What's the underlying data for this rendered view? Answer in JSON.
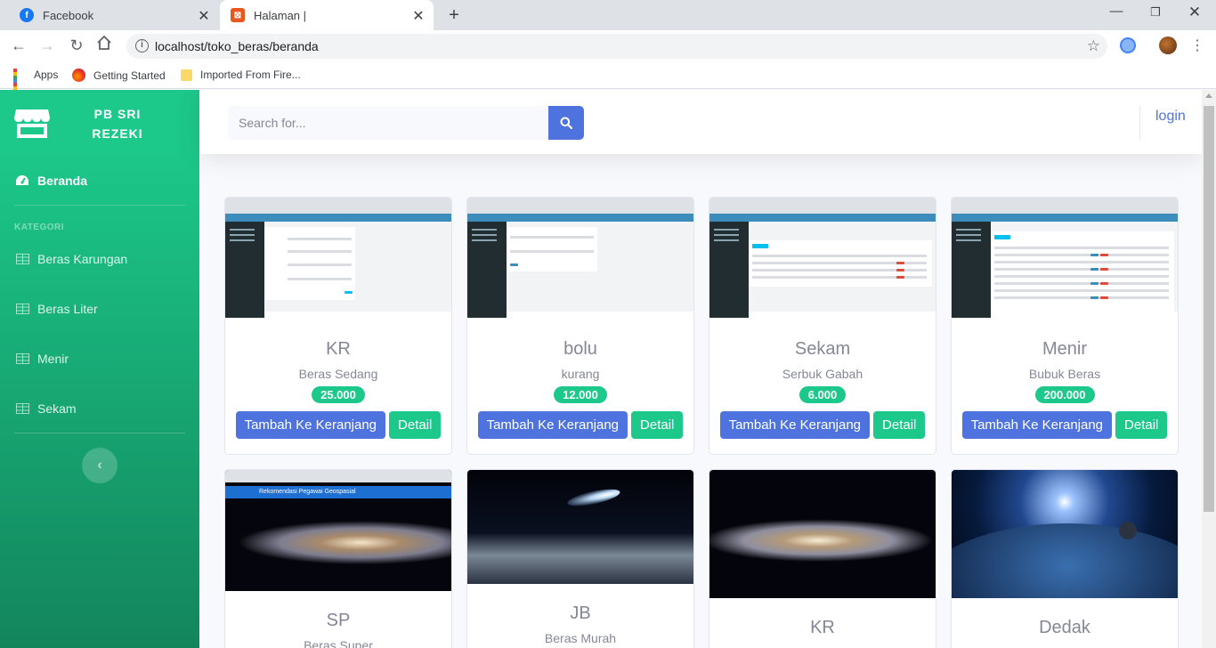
{
  "browser": {
    "tabs": [
      {
        "title": "Facebook"
      },
      {
        "title": "Halaman |"
      }
    ],
    "url": "localhost/toko_beras/beranda",
    "bookmarks": [
      {
        "label": "Apps"
      },
      {
        "label": "Getting Started"
      },
      {
        "label": "Imported From Fire..."
      }
    ]
  },
  "sidebar": {
    "brand": "PB SRI REZEKI",
    "dashboard_label": "Beranda",
    "heading": "KATEGORI",
    "items": [
      {
        "label": "Beras Karungan"
      },
      {
        "label": "Beras Liter"
      },
      {
        "label": "Menir"
      },
      {
        "label": "Sekam"
      }
    ]
  },
  "topbar": {
    "search_placeholder": "Search for...",
    "login": "login"
  },
  "products": [
    {
      "title": "KR",
      "subtitle": "Beras Sedang",
      "price": "25.000",
      "cart_label": "Tambah Ke Keranjang",
      "detail_label": "Detail"
    },
    {
      "title": "bolu",
      "subtitle": "kurang",
      "price": "12.000",
      "cart_label": "Tambah Ke Keranjang",
      "detail_label": "Detail"
    },
    {
      "title": "Sekam",
      "subtitle": "Serbuk Gabah",
      "price": "6.000",
      "cart_label": "Tambah Ke Keranjang",
      "detail_label": "Detail"
    },
    {
      "title": "Menir",
      "subtitle": "Bubuk Beras",
      "price": "200.000",
      "cart_label": "Tambah Ke Keranjang",
      "detail_label": "Detail"
    },
    {
      "title": "SP",
      "subtitle": "Beras Super"
    },
    {
      "title": "JB",
      "subtitle": "Beras Murah"
    },
    {
      "title": "KR"
    },
    {
      "title": "Dedak"
    }
  ],
  "thumb_texts": {
    "sp_banner": "Rekomendasi Pegawai Geospasial"
  },
  "colors": {
    "sidebar_top": "#1cc88a",
    "sidebar_bottom": "#13855c",
    "primary": "#4e73df",
    "success": "#1cc88a"
  }
}
